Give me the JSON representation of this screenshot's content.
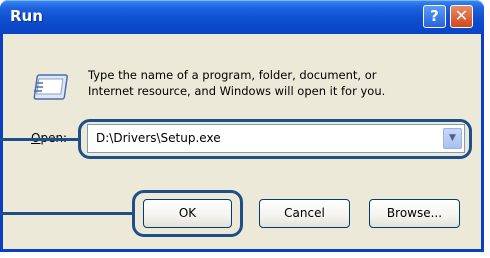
{
  "window": {
    "title": "Run",
    "help_glyph": "?",
    "close_glyph": "✕"
  },
  "dialog": {
    "icon": "run-program-icon",
    "description_line1": "Type the name of a program, folder, document, or",
    "description_line2": "Internet resource, and Windows will open it for you.",
    "open_label": "Open:",
    "open_value": "D:\\Drivers\\Setup.exe",
    "dropdown_glyph": "▼"
  },
  "buttons": {
    "ok": "OK",
    "cancel": "Cancel",
    "browse": "Browse..."
  },
  "colors": {
    "titlebar": "#0a44c6",
    "dialog_bg": "#ece9d8",
    "callout": "#1e4f86"
  }
}
